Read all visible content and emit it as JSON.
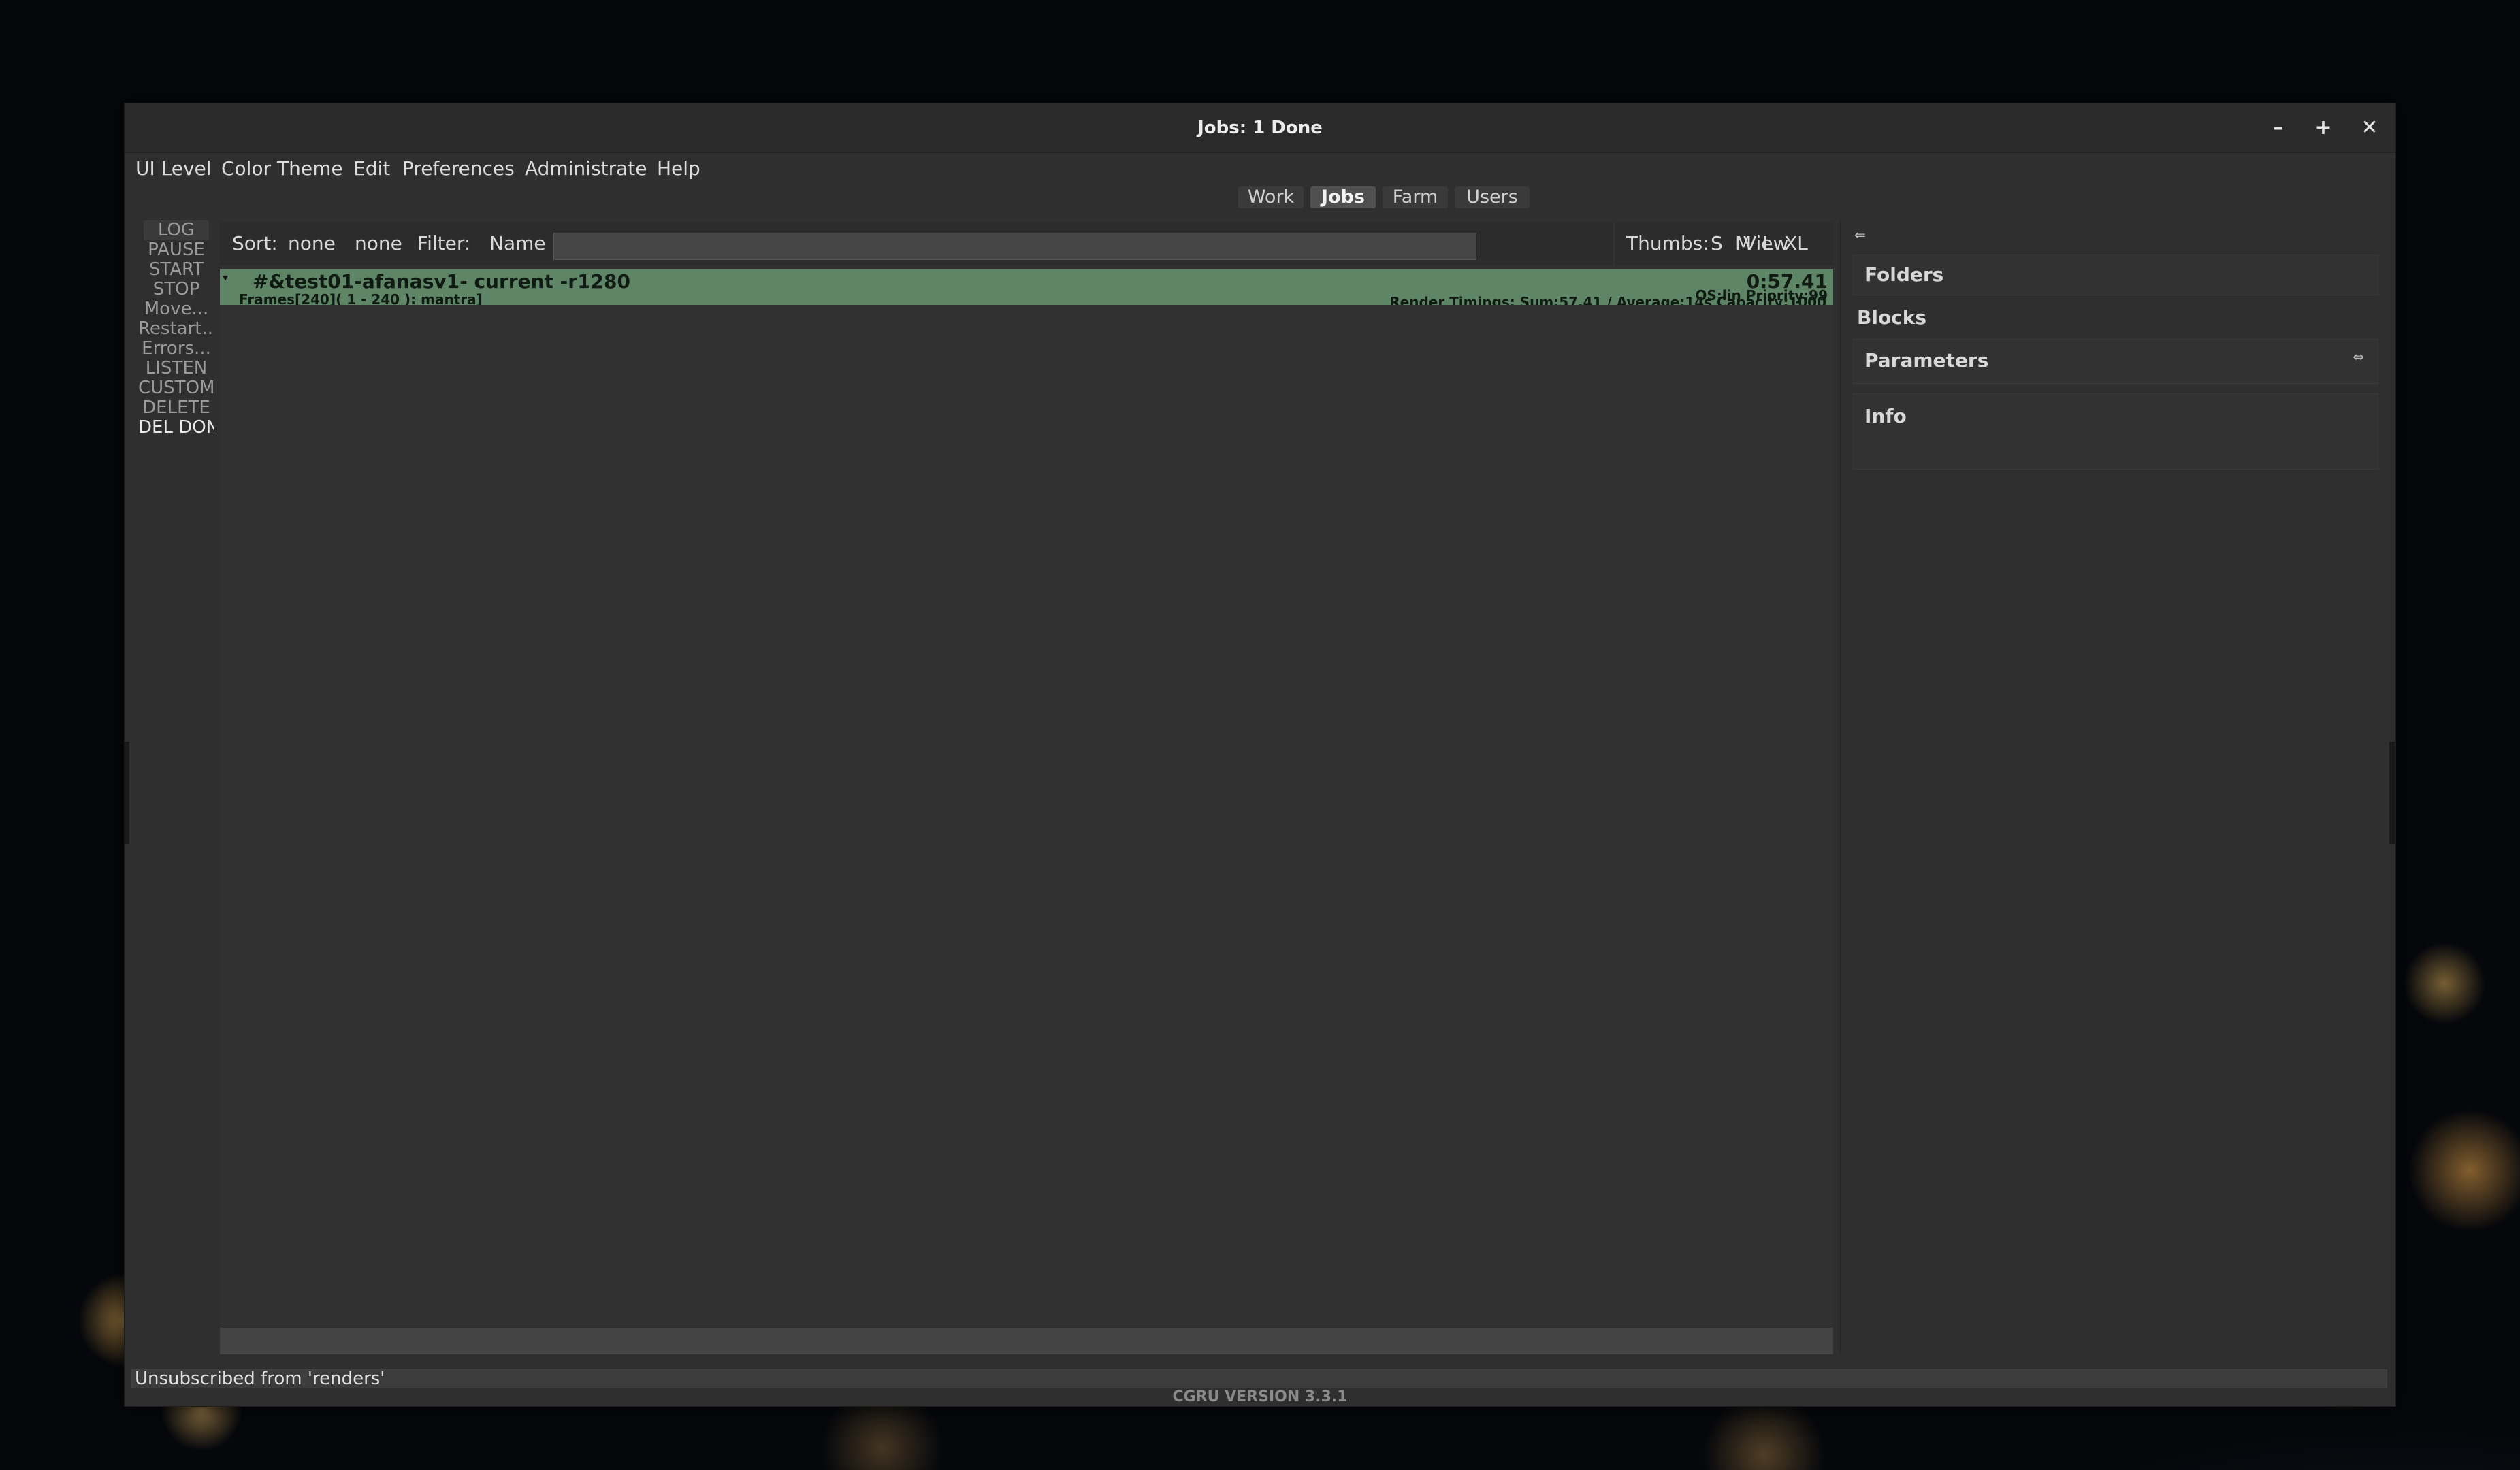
{
  "window": {
    "title": "Jobs: 1 Done"
  },
  "menubar": {
    "items": [
      "UI Level",
      "Color Theme",
      "Edit",
      "Preferences",
      "Administrate",
      "Help"
    ]
  },
  "tabs": {
    "items": [
      {
        "label": "Work",
        "active": false
      },
      {
        "label": "Jobs",
        "active": true
      },
      {
        "label": "Farm",
        "active": false
      },
      {
        "label": "Users",
        "active": false
      }
    ]
  },
  "actions": {
    "items": [
      "LOG",
      "PAUSE",
      "START",
      "STOP",
      "Move...",
      "Restart...",
      "Errors...",
      "LISTEN",
      "CUSTOM D",
      "DELETE",
      "DEL DON"
    ]
  },
  "sortbar": {
    "sort_label": "Sort:",
    "sort_value_1": "none",
    "sort_value_2": "none",
    "filter_label": "Filter:",
    "filter_field": "Name",
    "filter_value": ""
  },
  "thumbs": {
    "label": "Thumbs:",
    "sizes": [
      "S",
      "M",
      "L",
      "XL"
    ],
    "view_options": "View Options"
  },
  "jobs": [
    {
      "name": "#&test01-afanasv1- current -r1280",
      "subtitle": "Frames[240]( 1 - 240 ): mantra]",
      "runtime": "0:57.41",
      "priority": "OS:lin Priority:99",
      "timings": "Render Timings: Sum:57.41 / Average:14s Capacity:1000",
      "state_color": "#5e8565"
    }
  ],
  "right_panel": {
    "folders": "Folders",
    "blocks": "Blocks",
    "parameters": "Parameters",
    "info": "Info"
  },
  "status": {
    "message": "Unsubscribed from 'renders'",
    "version": "CGRU VERSION 3.3.1"
  },
  "icons": {
    "minimize": "minimize-icon",
    "maximize": "maximize-icon",
    "close": "close-icon",
    "collapse": "collapse-arrow-icon"
  }
}
